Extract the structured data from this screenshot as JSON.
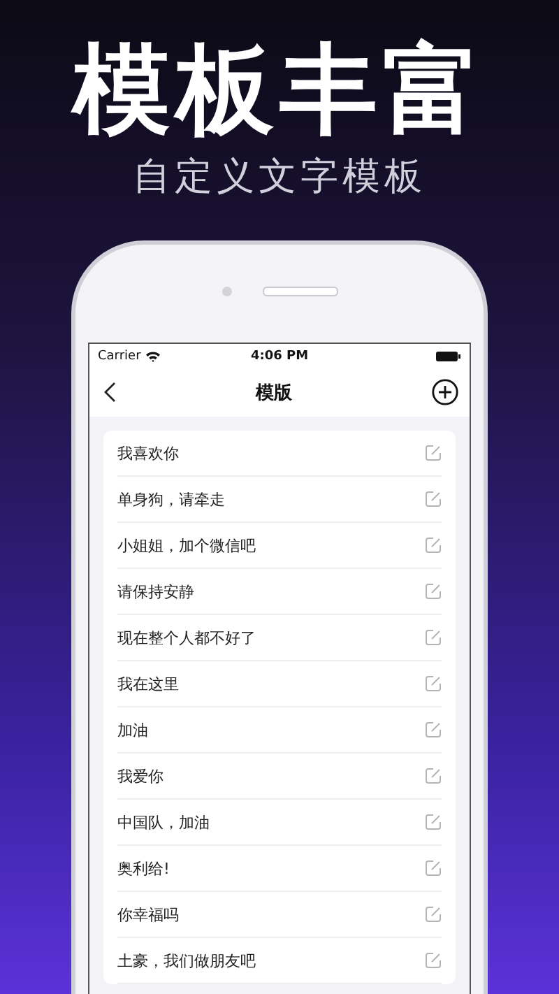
{
  "headline": "模板丰富",
  "subtitle": "自定义文字模板",
  "status_bar": {
    "carrier": "Carrier",
    "time": "4:06 PM"
  },
  "nav_bar": {
    "title": "模版"
  },
  "templates": [
    {
      "text": "我喜欢你"
    },
    {
      "text": "单身狗，请牵走"
    },
    {
      "text": "小姐姐，加个微信吧"
    },
    {
      "text": "请保持安静"
    },
    {
      "text": "现在整个人都不好了"
    },
    {
      "text": "我在这里"
    },
    {
      "text": "加油"
    },
    {
      "text": "我爱你"
    },
    {
      "text": "中国队，加油"
    },
    {
      "text": "奥利给!"
    },
    {
      "text": "你幸福吗"
    },
    {
      "text": "土豪，我们做朋友吧"
    }
  ]
}
